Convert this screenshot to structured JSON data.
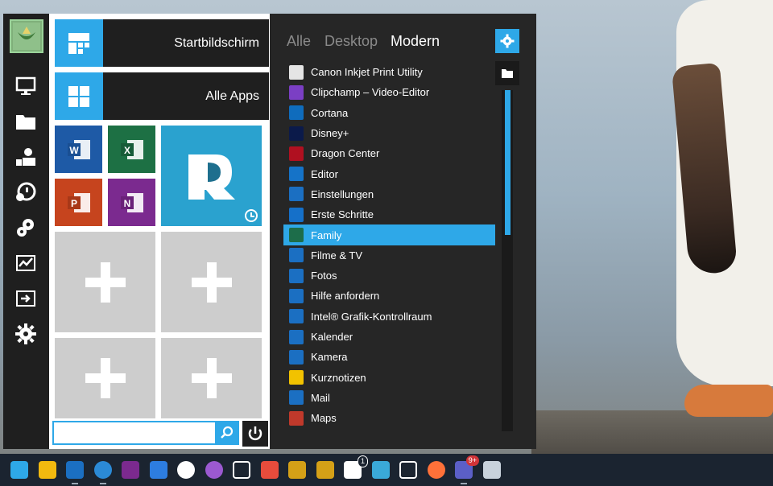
{
  "colors": {
    "accent": "#2ea8e8",
    "menu_bg": "#1f1f1f",
    "list_bg": "#262626",
    "taskbar_bg": "#1b2430"
  },
  "left_rail": {
    "items": [
      {
        "icon": "avatar-icon"
      },
      {
        "icon": "monitor-icon"
      },
      {
        "icon": "folder-icon"
      },
      {
        "icon": "users-icon"
      },
      {
        "icon": "network-icon"
      },
      {
        "icon": "gears-icon"
      },
      {
        "icon": "activity-chart-icon"
      },
      {
        "icon": "exit-screen-icon"
      },
      {
        "icon": "gear-icon"
      }
    ]
  },
  "tiles": {
    "start_screen_label": "Startbildschirm",
    "all_apps_label": "Alle Apps",
    "small_tiles": [
      {
        "name": "Word",
        "color": "#1e5aa6",
        "letter": "W"
      },
      {
        "name": "Excel",
        "color": "#1d7044",
        "letter": "X"
      },
      {
        "name": "PowerPoint",
        "color": "#c6441e",
        "letter": "P"
      },
      {
        "name": "OneNote",
        "color": "#7b2a8f",
        "letter": "N"
      }
    ],
    "big_tile_color": "#2aa2cf",
    "add_tiles": 4
  },
  "search": {
    "placeholder": "",
    "value": ""
  },
  "list": {
    "tabs": [
      {
        "label": "Alle",
        "active": false
      },
      {
        "label": "Desktop",
        "active": false
      },
      {
        "label": "Modern",
        "active": true
      }
    ],
    "apps": [
      {
        "label": "Canon Inkjet Print Utility",
        "color": "#e5e5e5"
      },
      {
        "label": "Clipchamp – Video-Editor",
        "color": "#7b3fc4"
      },
      {
        "label": "Cortana",
        "color": "#0f6cbd"
      },
      {
        "label": "Disney+",
        "color": "#0b1a4a"
      },
      {
        "label": "Dragon Center",
        "color": "#b01020"
      },
      {
        "label": "Editor",
        "color": "#1573c8"
      },
      {
        "label": "Einstellungen",
        "color": "#1b6fc2"
      },
      {
        "label": "Erste Schritte",
        "color": "#1570c9"
      },
      {
        "label": "Family",
        "color": "#1d6d4a",
        "selected": true
      },
      {
        "label": "Filme & TV",
        "color": "#1b6fc2"
      },
      {
        "label": "Fotos",
        "color": "#1b6fc2"
      },
      {
        "label": "Hilfe anfordern",
        "color": "#1b6fc2"
      },
      {
        "label": "Intel® Grafik-Kontrollraum",
        "color": "#1b6fc2"
      },
      {
        "label": "Kalender",
        "color": "#1b6fc2"
      },
      {
        "label": "Kamera",
        "color": "#1b6fc2"
      },
      {
        "label": "Kurznotizen",
        "color": "#f2c200"
      },
      {
        "label": "Mail",
        "color": "#1b6fc2"
      },
      {
        "label": "Maps",
        "color": "#c0392b"
      }
    ]
  },
  "taskbar": {
    "items": [
      {
        "icon": "start-menu-icon"
      },
      {
        "icon": "file-explorer-icon"
      },
      {
        "icon": "outlook-icon",
        "running": true
      },
      {
        "icon": "edge-icon",
        "running": true
      },
      {
        "icon": "onenote-icon"
      },
      {
        "icon": "todo-icon"
      },
      {
        "icon": "steam-icon"
      },
      {
        "icon": "circle-app-icon"
      },
      {
        "icon": "epic-games-icon"
      },
      {
        "icon": "game-app-icon"
      },
      {
        "icon": "ring-app-icon"
      },
      {
        "icon": "ring-app-2-icon"
      },
      {
        "icon": "chat-icon",
        "badge": "1"
      },
      {
        "icon": "dolphin-icon"
      },
      {
        "icon": "space-invader-icon"
      },
      {
        "icon": "firefox-icon"
      },
      {
        "icon": "teams-icon",
        "badge": "9+",
        "running": true
      },
      {
        "icon": "factory-icon"
      }
    ]
  }
}
